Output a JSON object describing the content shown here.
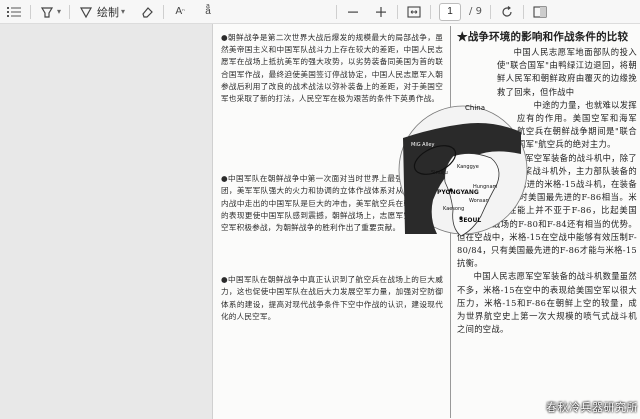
{
  "toolbar": {
    "draw_label": "绘制",
    "page_current": "1",
    "page_total": "/ 9"
  },
  "document": {
    "left_paragraphs": [
      "●朝鲜战争是第二次世界大战后爆发的规模最大的局部战争，虽然美帝国主义和中国军队战斗力上存在较大的差距，中国人民志愿军在战场上抵抗美军的强大攻势，以劣势装备同美国为首的联合国军作战，最终迫使美国签订停战协定，中国人民志愿军入朝参战后利用了改良的战术战法以弥补装备上的差距，对于美国空军也采取了新的打法，人民空军在极为艰苦的条件下英勇作战。",
      "●中国军队在朝鲜战争中第一次面对当时世界上最强大的武装集团，美军军队强大的火力和协调的立体作战体系对从抗日战争和内战中走出的中国军队是巨大的冲击，美军航空兵在朝鲜战场上的表现更使中国军队感到震撼，朝鲜战场上，志愿军空军和人民空军积极参战，为朝鲜战争的胜利作出了重要贡献。",
      "●中国军队在朝鲜战争中真正认识到了航空兵在战场上的巨大威力，这也促使中国军队在战后大力发展空军力量，加强对空防御体系的建设，提高对现代战争条件下空中作战的认识，建设现代化的人民空军。"
    ],
    "right_title": "★战争环境的影响和作战条件的比较",
    "right_subtitle": "★战争环境的影响和作战条件的比较",
    "right_paragraphs_top": [
      "中国人民志愿军地面部队的投入使\"联合国军\"由鸭绿江边退回，将朝鲜人民军和朝鲜政府由覆灭的边缘挽救了回来，但作战中",
      "中途的力量，也就难以发挥应有的作用。美国空军和海军航空兵在朝鲜战争期间是\"联合国军\"航空兵的绝对主力。"
    ],
    "right_subtitle2": "★战争环境的影响和作战条件的比较",
    "right_paragraphs_bottom": [
      "中国人民志愿军空军装备的战斗机中，除了少量的拉-11螺旋桨战斗机外，主力部队装备的都是苏联当时最先进的米格-15战斗机，在装备技术水平上与当时美国最先进的F-86相当。米格-15在飞行性能上并不亚于F-86，比起美国空军投入战场的F-80和F-84还有相当的优势。但在空战中，米格-15在空战中能够有效压制F-80/84，只有美国最先进的F-86才能与米格-15抗衡。",
      "中国人民志愿军空军装备的战斗机数量虽然不多，米格-15在空中的表现给美国空军以很大压力，米格-15和F-86在朝鲜上空的较量，成为世界航空史上第一次大规模的喷气式战斗机之间的空战。"
    ],
    "map_labels": {
      "china": "China",
      "mig_alley": "MiG Alley",
      "kanggye": "Kanggye",
      "sinuiju": "Sinuiju",
      "pyongyang": "PYONGYANG",
      "hungnam": "Hungnam",
      "wonsan": "Wonsan",
      "kaesong": "Kaesong",
      "seoul": "SEOUL"
    }
  },
  "watermark": "春秋冷兵器研究所"
}
